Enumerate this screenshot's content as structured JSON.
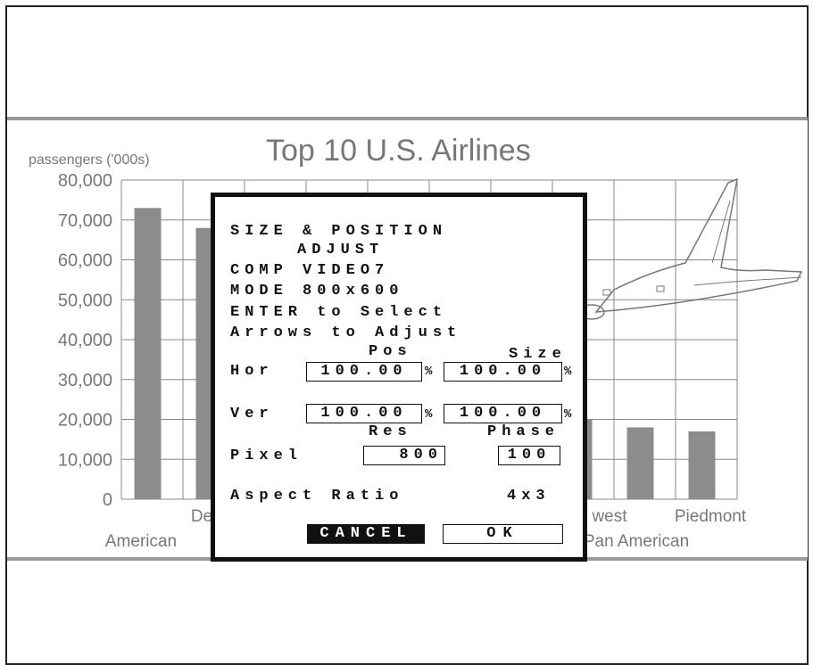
{
  "colors": {
    "bar": "#8c8c8c",
    "grid": "#888888",
    "text": "#777777",
    "band": "#999999"
  },
  "chart_data": {
    "type": "bar",
    "title": "Top 10 U.S. Airlines",
    "ylabel": "passengers ('000s)",
    "ylim": [
      0,
      80000
    ],
    "yticks": [
      "0",
      "10,000",
      "20,000",
      "30,000",
      "40,000",
      "50,000",
      "60,000",
      "70,000",
      "80,000"
    ],
    "categories": [
      "American",
      "Delta",
      "",
      "",
      "",
      "",
      "",
      "Northwest",
      "Pan American",
      "Piedmont"
    ],
    "visible_category_labels": [
      "American",
      "De",
      "west",
      "Pan American",
      "Piedmont"
    ],
    "values": [
      73000,
      68000,
      null,
      null,
      null,
      null,
      null,
      20000,
      18000,
      17000
    ],
    "grid": true,
    "decoration": "airplane-illustration"
  },
  "osd": {
    "title_line1": "SIZE & POSITION",
    "title_line2": "ADJUST",
    "source": "COMP VIDEO7",
    "mode": "MODE 800x600",
    "instruction1": "ENTER to Select",
    "instruction2": "Arrows to Adjust",
    "col_pos": "Pos",
    "col_size": "Size",
    "hor_label": "Hor",
    "hor_pos": "100.00",
    "hor_size": "100.00",
    "ver_label": "Ver",
    "ver_pos": "100.00",
    "ver_size": "100.00",
    "percent": "%",
    "col_res": "Res",
    "col_phase": "Phase",
    "pixel_label": "Pixel",
    "pixel_res": "800",
    "pixel_phase": "100",
    "aspect_label": "Aspect Ratio",
    "aspect_value": "4x3",
    "cancel_label": "CANCEL",
    "ok_label": "OK"
  }
}
